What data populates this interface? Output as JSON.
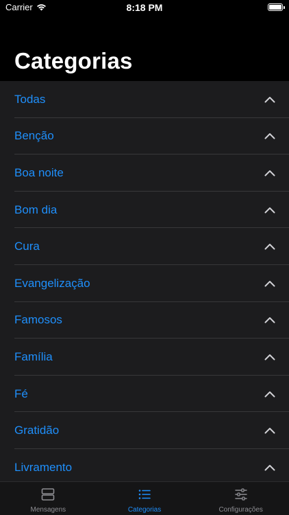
{
  "status_bar": {
    "carrier": "Carrier",
    "time": "8:18 PM"
  },
  "header": {
    "title": "Categorias"
  },
  "categories": [
    {
      "label": "Todas"
    },
    {
      "label": "Benção"
    },
    {
      "label": "Boa noite"
    },
    {
      "label": "Bom dia"
    },
    {
      "label": "Cura"
    },
    {
      "label": "Evangelização"
    },
    {
      "label": "Famosos"
    },
    {
      "label": "Família"
    },
    {
      "label": "Fé"
    },
    {
      "label": "Gratidão"
    },
    {
      "label": "Livramento"
    }
  ],
  "tab_bar": {
    "tabs": [
      {
        "label": "Mensagens",
        "icon": "messages-icon",
        "active": false
      },
      {
        "label": "Categorias",
        "icon": "list-icon",
        "active": true
      },
      {
        "label": "Configurações",
        "icon": "sliders-icon",
        "active": false
      }
    ]
  },
  "colors": {
    "accent": "#1f8ffb",
    "background": "#000000",
    "list_background": "#1c1c1e",
    "inactive_tab": "#8e8e93"
  }
}
